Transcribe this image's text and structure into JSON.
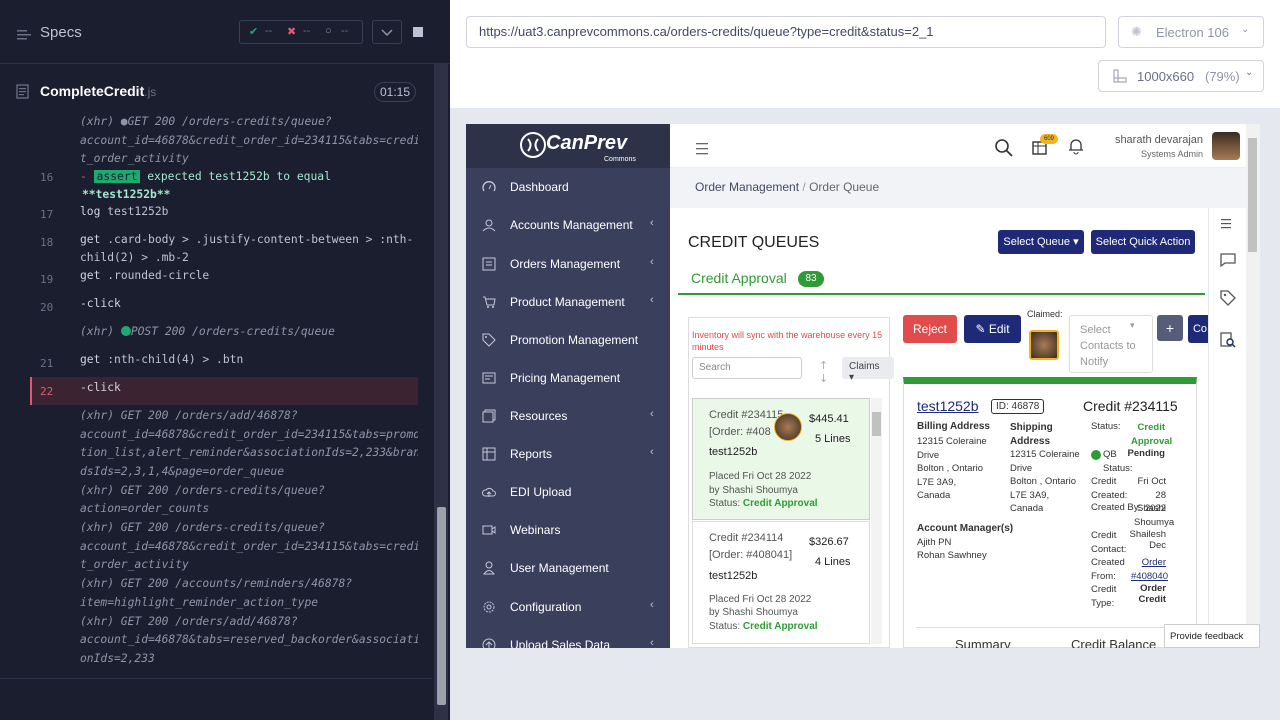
{
  "runner": {
    "specs_label": "Specs",
    "stats": {
      "passed": "--",
      "failed": "--",
      "pending": "--"
    },
    "test_name": "CompleteCredit",
    "test_ext": ".js",
    "timer": "01:15",
    "log": [
      {
        "num": "",
        "lines": [
          "(xhr)  ●GET 200 /orders-credits/queue?",
          "account_id=46878&credit_order_id=234115&tabs=credi",
          "t_order_activity"
        ]
      },
      {
        "num": "16",
        "assert_prefix": "-",
        "assert_tag": "assert",
        "assert_text": "expected test1252b to equal",
        "assert_value": "**test1252b**"
      },
      {
        "num": "17",
        "cmd": "log",
        "arg": "test1252b"
      },
      {
        "num": "18",
        "cmd": "get",
        "arg": ".card-body > .justify-content-between > :nth-",
        "arg2": "child(2) > .mb-2"
      },
      {
        "num": "19",
        "cmd": "get",
        "arg": ".rounded-circle"
      },
      {
        "num": "20",
        "cmd": "-click"
      },
      {
        "num": "",
        "xhr": "(xhr)",
        "method": "POST 200 /orders-credits/queue"
      },
      {
        "num": "21",
        "cmd": "get",
        "arg": ":nth-child(4) > .btn"
      },
      {
        "num": "22",
        "cmd": "-click"
      },
      {
        "num": "",
        "xhr_lines": [
          "(xhr)  GET 200 /orders/add/46878?",
          "account_id=46878&credit_order_id=234115&tabs=promo",
          "tion_list,alert_reminder&associationIds=2,233&bran",
          "dsIds=2,3,1,4&page=order_queue",
          "(xhr)  GET 200 /orders-credits/queue?",
          "action=order_counts",
          "(xhr)  GET 200 /orders-credits/queue?",
          "account_id=46878&credit_order_id=234115&tabs=credi",
          "t_order_activity",
          "(xhr)  GET 200 /accounts/reminders/46878?",
          "item=highlight_reminder_action_type",
          "(xhr)  GET 200 /orders/add/46878?",
          "account_id=46878&tabs=reserved_backorder&associati",
          "onIds=2,233"
        ]
      }
    ]
  },
  "browser": {
    "url": "https://uat3.canprevcommons.ca/orders-credits/queue?type=credit&status=2_1",
    "engine": "Electron 106",
    "viewport": "1000x660",
    "zoom": "(79%)"
  },
  "app": {
    "logo_text": "CanPrev",
    "logo_sub": "Commons",
    "user_name": "sharath devarajan",
    "user_role": "Systems Admin",
    "cart_badge": "609",
    "nav": [
      "Dashboard",
      "Accounts Management",
      "Orders Management",
      "Product Management",
      "Promotion Management",
      "Pricing Management",
      "Resources",
      "Reports",
      "EDI Upload",
      "Webinars",
      "User Management",
      "Configuration",
      "Upload Sales Data"
    ],
    "breadcrumb": [
      "Order Management",
      "Order Queue"
    ],
    "page_title": "CREDIT QUEUES",
    "select_queue": "Select Queue",
    "select_quick_action": "Select Quick Action",
    "tab_label": "Credit Approval",
    "tab_count": "83",
    "inventory_note": "Inventory will sync with the warehouse every 15 minutes",
    "search_placeholder": "Search",
    "claims_label": "Claims",
    "reject_label": "Reject",
    "edit_label": "Edit",
    "claimed_label": "Claimed:",
    "contacts_placeholder": "Select Contacts to Notify",
    "add_label": "+",
    "co_label": "Co",
    "cards": [
      {
        "credit": "Credit #234115",
        "order": "[Order: #408",
        "amount": "$445.41",
        "lines": "5 Lines",
        "name": "test1252b",
        "placed": "Placed Fri Oct 28 2022",
        "by": "by Shashi Shoumya",
        "status_label": "Status:",
        "status": "Credit Approval"
      },
      {
        "credit": "Credit #234114",
        "order": "[Order: #408041]",
        "amount": "$326.67",
        "lines": "4 Lines",
        "name": "test1252b",
        "placed": "Placed Fri Oct 28 2022",
        "by": "by Shashi Shoumya",
        "status_label": "Status:",
        "status": "Credit Approval"
      }
    ],
    "detail": {
      "account": "test1252b",
      "id": "ID: 46878",
      "credit": "Credit #234115",
      "billing_label": "Billing Address",
      "billing": [
        "12315 Coleraine",
        "Drive",
        "Bolton , Ontario",
        "L7E 3A9,",
        "Canada"
      ],
      "shipping_label": "Shipping Address",
      "shipping": [
        "12315 Coleraine",
        "Drive",
        "Bolton , Ontario",
        "L7E 3A9,",
        "Canada"
      ],
      "status_label": "Status:",
      "status_value": "Credit Approval",
      "pending": "Pending",
      "qb_label": "QB Status:",
      "credit_created_label": "Credit Created:",
      "credit_created": "Fri Oct 28 2022",
      "created_by_label": "Created By:",
      "created_by": "Shashi Shoumya",
      "credit_contact_label": "Credit Contact:",
      "credit_contact": "Shailesh Dec",
      "created_from_label": "Created From:",
      "created_from": "Order #408040",
      "credit_type_label": "Credit Type:",
      "credit_type": "Order Credit",
      "managers_label": "Account Manager(s)",
      "managers": [
        "Ajith PN",
        "Rohan Sawhney"
      ],
      "summary": "Summary",
      "credit_balance": "Credit Balance"
    },
    "feedback": "Provide feedback"
  }
}
